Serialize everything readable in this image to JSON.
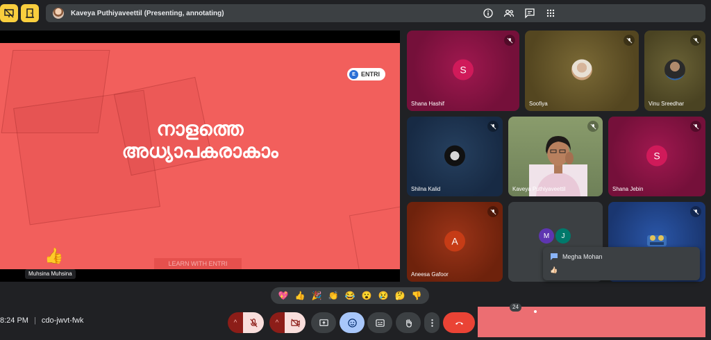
{
  "topbar": {
    "presenting_text": "Kaveya Puthiyaveettil (Presenting, annotating)",
    "icons": [
      "presentation-off-icon",
      "door-icon"
    ],
    "accent": "#f9ce3e"
  },
  "slide": {
    "title_line1": "നാളത്തെ",
    "title_line2": "അധ്യാപകരാകാം",
    "brand_logo": "E",
    "brand": "ENTRI",
    "footer": "LEARN WITH ENTRI",
    "background": "#f25f5c",
    "reaction_emoji": "👍",
    "reaction_by": "Muhsina Muhsina"
  },
  "tiles": {
    "shana_hashif": {
      "name": "Shana Hashif",
      "initial": "S",
      "avatar_color": "#d01a5a"
    },
    "soofiya": {
      "name": "Soofiya"
    },
    "vinu_sreedhar": {
      "name": "Vinu Sreedhar"
    },
    "shilna_kalid": {
      "name": "Shilna Kalid"
    },
    "kaveya": {
      "name": "Kaveya Puthiyaveettil"
    },
    "shana_jebin": {
      "name": "Shana Jebin",
      "initial": "S",
      "avatar_color": "#d01a5a"
    },
    "aneesa_gafoor": {
      "name": "Aneesa Gafoor",
      "initial": "A",
      "avatar_color": "#c63c16"
    },
    "others": {
      "initials": [
        "M",
        "J"
      ],
      "colors": [
        "#5e35b1",
        "#00796b"
      ]
    }
  },
  "chat_popup": {
    "sender": "Megha Mohan",
    "message": "👍🏻"
  },
  "emoji_bar": [
    "💖",
    "👍",
    "🎉",
    "👏",
    "😂",
    "😮",
    "😢",
    "🤔",
    "👎"
  ],
  "bottom": {
    "time": "8:24 PM",
    "separator": "|",
    "meeting_code": "cdo-jwvt-fwk",
    "chevron": "^",
    "people_count": "24"
  }
}
